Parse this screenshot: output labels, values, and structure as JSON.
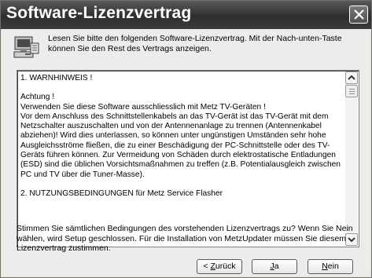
{
  "window": {
    "title": "Software-Lizenzvertrag"
  },
  "intro": {
    "text": "Lesen Sie bitte den folgenden Software-Lizenzvertrag. Mit der Nach-unten-Taste können Sie den Rest des Vertrags anzeigen."
  },
  "license": {
    "paragraphs": [
      "1. WARNHINWEIS !",
      "Achtung !\nVerwenden Sie diese Software ausschliesslich mit Metz TV-Geräten !\nVor dem Anschluss des Schnittstellenkabels an das TV-Gerät ist das TV-Gerät mit dem Netzschalter auszuschalten und von der Antennenanlage zu trennen (Antennenkabel abziehen)! Wird dies unterlassen, so können unter ungünstigen Umständen sehr hohe Ausgleichsströme fließen, die zu einer Beschädigung der PC-Schnittstelle oder des TV-Geräts führen können. Zur Vermeidung von Schäden durch elektrostatische Entladungen (ESD) sind die üblichen Vorsichtsmaßnahmen zu treffen (z.B. Potentialausgleich zwischen PC und TV über die Tuner-Masse).",
      "2. NUTZUNGSBEDINGUNGEN für Metz Service Flasher"
    ]
  },
  "question": {
    "text": "Stimmen Sie sämtlichen Bedingungen des vorstehenden Lizenzvertrags zu? Wenn Sie Nein wählen, wird Setup geschlossen. Für die Installation von MetzUpdater müssen Sie diesem Lizenzvertrag zustimmen."
  },
  "buttons": {
    "back": {
      "prefix": "< ",
      "mnemonic": "Z",
      "rest": "urück"
    },
    "yes": {
      "prefix": "",
      "mnemonic": "J",
      "rest": "a"
    },
    "no": {
      "prefix": "",
      "mnemonic": "N",
      "rest": "ein"
    }
  },
  "icons": {
    "close": "close-icon",
    "setup": "setup-computer-icon",
    "scroll_up": "arrow-up-icon",
    "scroll_down": "arrow-down-icon"
  }
}
